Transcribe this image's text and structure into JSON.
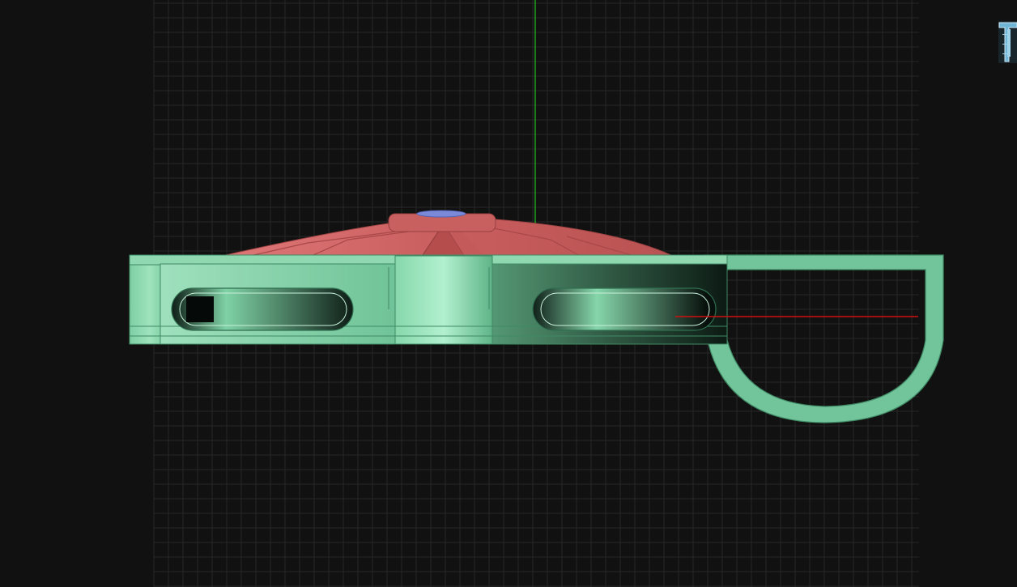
{
  "viewport": {
    "background": "#111111",
    "grid_color": "#262626",
    "y_axis_color": "#1fa01f",
    "x_axis_color": "#d01010"
  },
  "model": {
    "fixture_color": "#72c49a",
    "fixture_dark": "#0b1712",
    "fixture_outline": "#3f8a65",
    "dome_color": "#d36868",
    "dome_dark": "#a84848",
    "cap_color": "#7a8ad8"
  },
  "navigation": {
    "icon": "view-cube-icon"
  }
}
